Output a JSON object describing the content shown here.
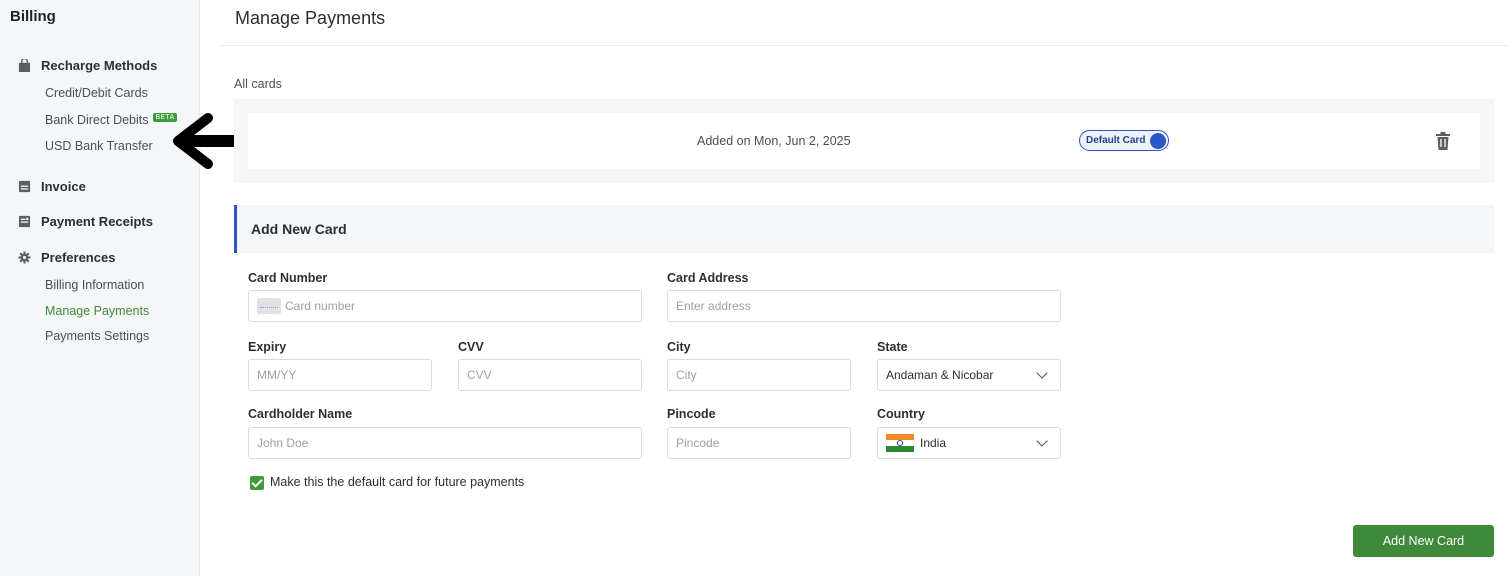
{
  "sidebar": {
    "title": "Billing",
    "recharge_methods": {
      "label": "Recharge Methods",
      "items": [
        {
          "label": "Credit/Debit Cards"
        },
        {
          "label": "Bank Direct Debits",
          "badge": "BETA"
        },
        {
          "label": "USD Bank Transfer"
        }
      ]
    },
    "invoice": {
      "label": "Invoice"
    },
    "payment_receipts": {
      "label": "Payment Receipts"
    },
    "preferences": {
      "label": "Preferences",
      "items": [
        {
          "label": "Billing Information"
        },
        {
          "label": "Manage Payments",
          "active": true
        },
        {
          "label": "Payments Settings"
        }
      ]
    }
  },
  "header": {
    "title": "Manage Payments"
  },
  "cards": {
    "section_label": "All cards",
    "list": [
      {
        "added_on": "Added on Mon, Jun 2, 2025",
        "default_label": "Default Card",
        "is_default": true
      }
    ]
  },
  "add_card": {
    "title": "Add New Card",
    "card_number": {
      "label": "Card Number",
      "placeholder": "Card number"
    },
    "expiry": {
      "label": "Expiry",
      "placeholder": "MM/YY"
    },
    "cvv": {
      "label": "CVV",
      "placeholder": "CVV"
    },
    "cardholder": {
      "label": "Cardholder Name",
      "placeholder": "John Doe"
    },
    "address": {
      "label": "Card Address",
      "placeholder": "Enter address"
    },
    "city": {
      "label": "City",
      "placeholder": "City"
    },
    "state": {
      "label": "State",
      "value": "Andaman & Nicobar"
    },
    "pincode": {
      "label": "Pincode",
      "placeholder": "Pincode"
    },
    "country": {
      "label": "Country",
      "value": "India"
    },
    "default_checkbox": {
      "label": "Make this the default card for future payments",
      "checked": true
    },
    "submit_label": "Add New Card"
  },
  "colors": {
    "accent_green": "#3f8a3a",
    "accent_blue": "#2a56c6",
    "annotation_arrow": "#000000"
  }
}
